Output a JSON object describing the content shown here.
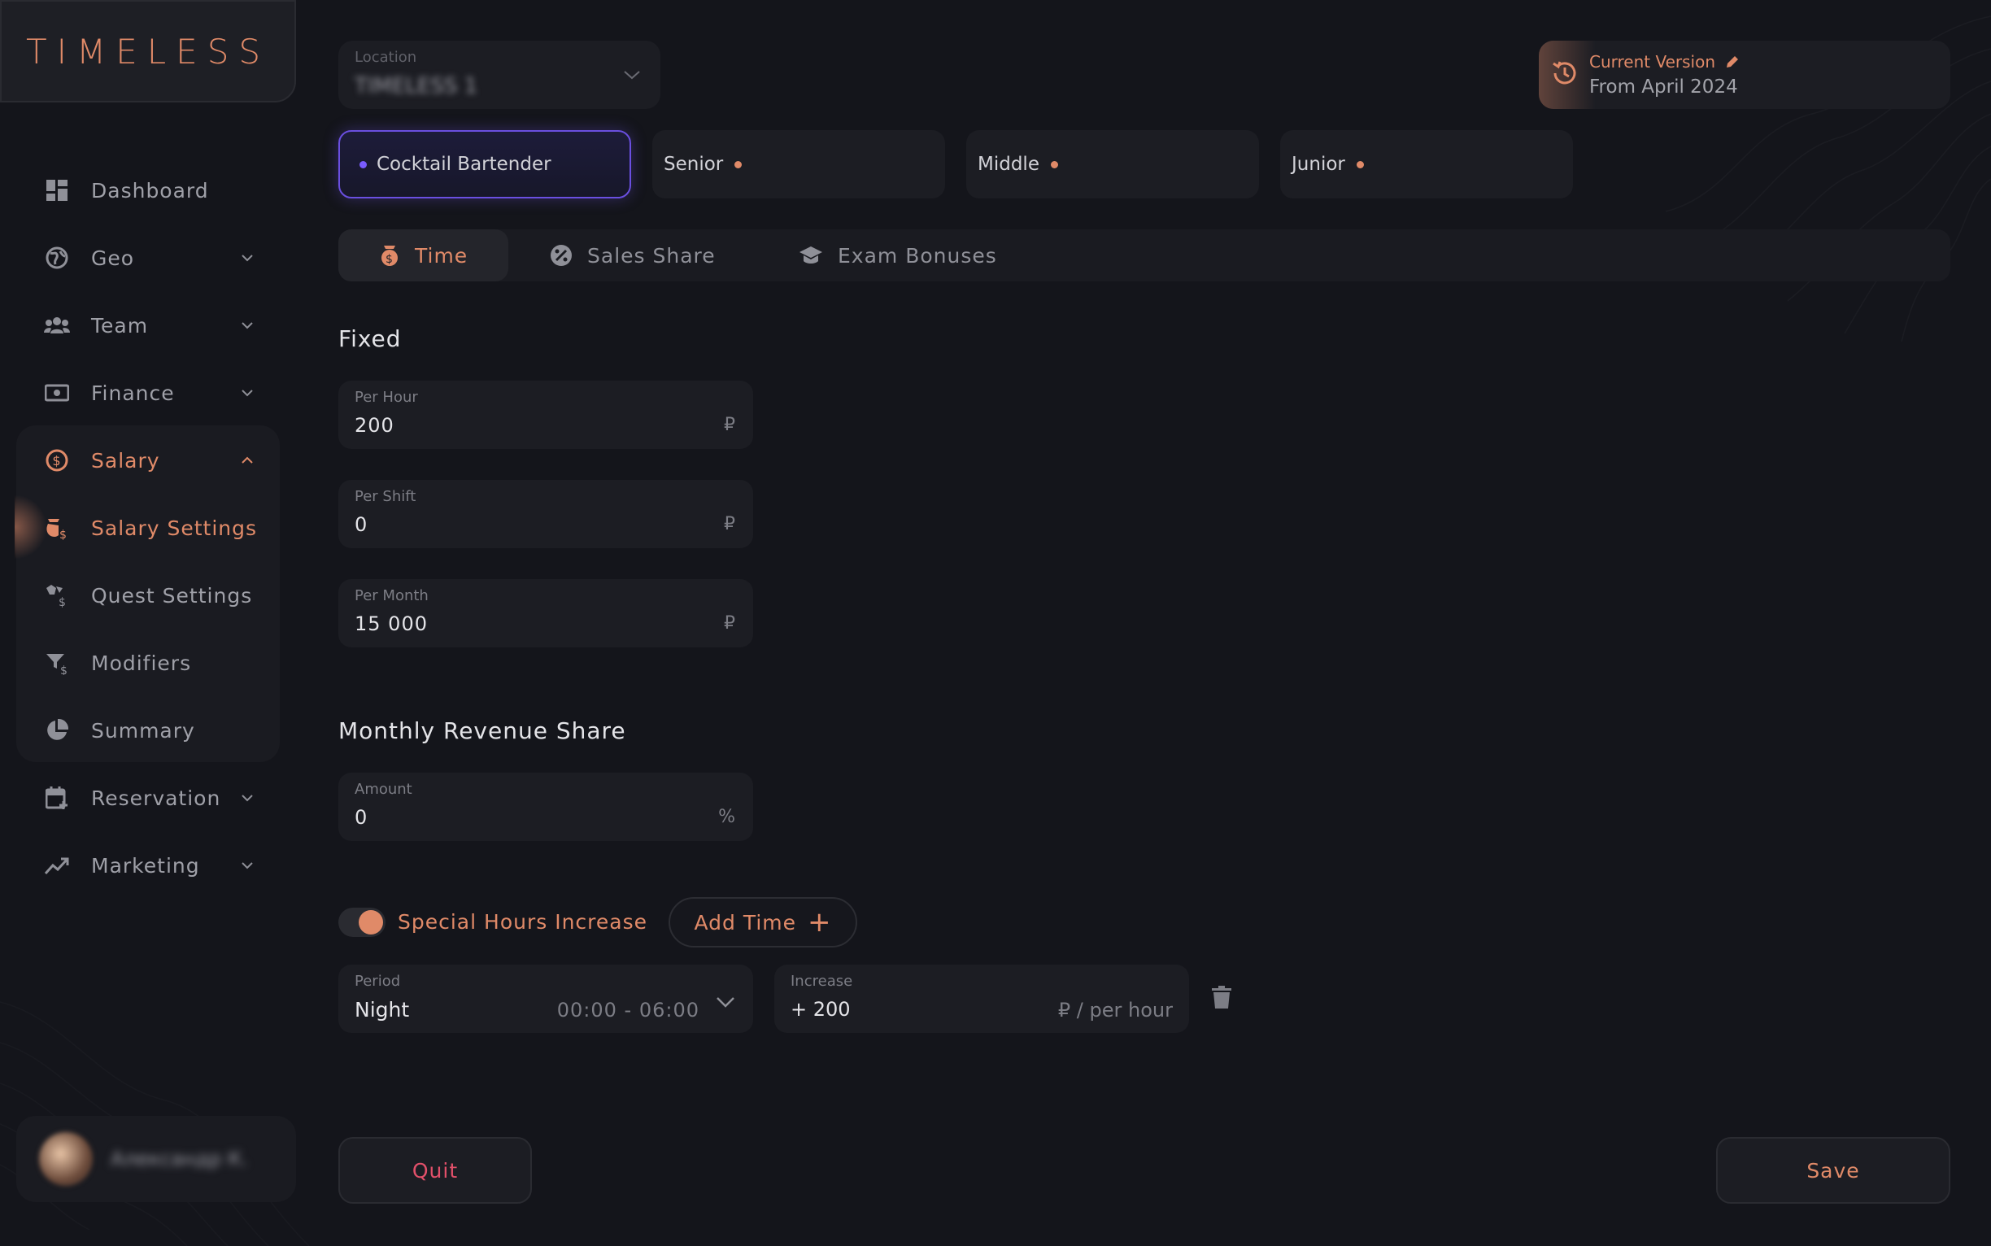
{
  "brand": {
    "logo": "TIMELESS",
    "accent_color": "#e08a68"
  },
  "sidebar": {
    "items": [
      {
        "label": "Dashboard",
        "icon": "dashboard-icon"
      },
      {
        "label": "Geo",
        "icon": "globe-icon"
      },
      {
        "label": "Team",
        "icon": "team-icon"
      },
      {
        "label": "Finance",
        "icon": "cash-icon"
      },
      {
        "label": "Salary",
        "icon": "dollar-circle-icon"
      },
      {
        "label": "Salary Settings",
        "icon": "salary-settings-icon"
      },
      {
        "label": "Quest Settings",
        "icon": "quest-icon"
      },
      {
        "label": "Modifiers",
        "icon": "filter-dollar-icon"
      },
      {
        "label": "Summary",
        "icon": "pie-chart-icon"
      },
      {
        "label": "Reservation",
        "icon": "calendar-plus-icon"
      },
      {
        "label": "Marketing",
        "icon": "trend-icon"
      }
    ],
    "user": {
      "name": "Александр К."
    }
  },
  "location": {
    "label": "Location",
    "value": "TIMELESS 1"
  },
  "version": {
    "title": "Current Version",
    "subtitle": "From April 2024"
  },
  "roles": [
    "Cocktail Bartender",
    "Senior",
    "Middle",
    "Junior"
  ],
  "tabs": [
    "Time",
    "Sales Share",
    "Exam Bonuses"
  ],
  "fixed": {
    "title": "Fixed",
    "per_hour": {
      "label": "Per Hour",
      "value": "200",
      "unit": "₽"
    },
    "per_shift": {
      "label": "Per Shift",
      "value": "0",
      "unit": "₽"
    },
    "per_month": {
      "label": "Per Month",
      "value": "15 000",
      "unit": "₽"
    }
  },
  "revenue": {
    "title": "Monthly Revenue Share",
    "amount": {
      "label": "Amount",
      "value": "0",
      "unit": "%"
    }
  },
  "special": {
    "label": "Special Hours Increase",
    "enabled": true,
    "add_time_label": "Add Time",
    "period": {
      "label": "Period",
      "value": "Night",
      "range": "00:00 - 06:00"
    },
    "increase": {
      "label": "Increase",
      "value": "+ 200",
      "unit": "₽ / per hour"
    }
  },
  "actions": {
    "quit": "Quit",
    "save": "Save"
  }
}
